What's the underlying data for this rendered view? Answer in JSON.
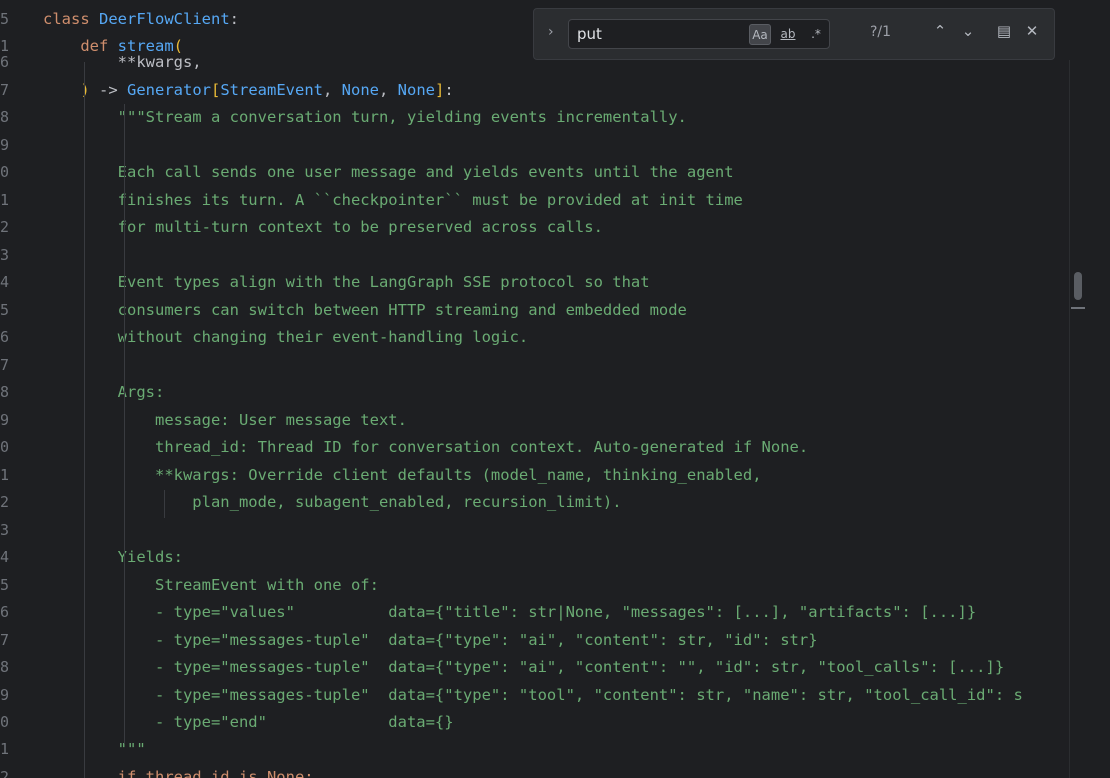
{
  "editor": {
    "lines": [
      {
        "n": "5",
        "html_parts": [
          {
            "t": "class ",
            "c": "kw"
          },
          {
            "t": "DeerFlowClient",
            "c": "cls"
          },
          {
            "t": ":",
            "c": "punc"
          }
        ]
      },
      {
        "n": "1",
        "html_parts": [
          {
            "t": "    def ",
            "c": "kw"
          },
          {
            "t": "stream",
            "c": "fn"
          },
          {
            "t": "(",
            "c": "brk"
          }
        ]
      },
      {
        "n": "6",
        "html_parts": [
          {
            "t": "        **kwargs,",
            "c": "punc"
          }
        ]
      },
      {
        "n": "7",
        "html_parts": [
          {
            "t": "    ",
            "c": "punc"
          },
          {
            "t": ")",
            "c": "brk"
          },
          {
            "t": " -> ",
            "c": "punc"
          },
          {
            "t": "Generator",
            "c": "cls"
          },
          {
            "t": "[",
            "c": "brk"
          },
          {
            "t": "StreamEvent",
            "c": "cls"
          },
          {
            "t": ", ",
            "c": "punc"
          },
          {
            "t": "None",
            "c": "none"
          },
          {
            "t": ", ",
            "c": "punc"
          },
          {
            "t": "None",
            "c": "none"
          },
          {
            "t": "]",
            "c": "brk"
          },
          {
            "t": ":",
            "c": "punc"
          }
        ]
      },
      {
        "n": "8",
        "html_parts": [
          {
            "t": "        \"\"\"Stream a conversation turn, yielding events incrementally.",
            "c": "doc"
          }
        ]
      },
      {
        "n": "9",
        "html_parts": []
      },
      {
        "n": "0",
        "html_parts": [
          {
            "t": "        Each call sends one user message and yields events until the agent",
            "c": "doc"
          }
        ]
      },
      {
        "n": "1",
        "html_parts": [
          {
            "t": "        finishes its turn. A ``checkpointer`` must be provided at init time",
            "c": "doc"
          }
        ]
      },
      {
        "n": "2",
        "html_parts": [
          {
            "t": "        for multi-turn context to be preserved across calls.",
            "c": "doc"
          }
        ]
      },
      {
        "n": "3",
        "html_parts": []
      },
      {
        "n": "4",
        "html_parts": [
          {
            "t": "        Event types align with the LangGraph SSE protocol so that",
            "c": "doc"
          }
        ]
      },
      {
        "n": "5",
        "html_parts": [
          {
            "t": "        consumers can switch between HTTP streaming and embedded mode",
            "c": "doc"
          }
        ]
      },
      {
        "n": "6",
        "html_parts": [
          {
            "t": "        without changing their event-handling logic.",
            "c": "doc"
          }
        ]
      },
      {
        "n": "7",
        "html_parts": []
      },
      {
        "n": "8",
        "html_parts": [
          {
            "t": "        Args:",
            "c": "doc"
          }
        ]
      },
      {
        "n": "9",
        "html_parts": [
          {
            "t": "            message: User message text.",
            "c": "doc"
          }
        ]
      },
      {
        "n": "0",
        "html_parts": [
          {
            "t": "            thread_id: Thread ID for conversation context. Auto-generated if None.",
            "c": "doc"
          }
        ]
      },
      {
        "n": "1",
        "html_parts": [
          {
            "t": "            **kwargs: Override client defaults (model_name, thinking_enabled,",
            "c": "doc"
          }
        ]
      },
      {
        "n": "2",
        "html_parts": [
          {
            "t": "                plan_mode, subagent_enabled, recursion_limit).",
            "c": "doc"
          }
        ]
      },
      {
        "n": "3",
        "html_parts": []
      },
      {
        "n": "4",
        "html_parts": [
          {
            "t": "        Yields:",
            "c": "doc"
          }
        ]
      },
      {
        "n": "5",
        "html_parts": [
          {
            "t": "            StreamEvent with one of:",
            "c": "doc"
          }
        ]
      },
      {
        "n": "6",
        "html_parts": [
          {
            "t": "            - type=\"values\"          data={\"title\": str|None, \"messages\": [...], \"artifacts\": [...]}",
            "c": "doc"
          }
        ]
      },
      {
        "n": "7",
        "html_parts": [
          {
            "t": "            - type=\"messages-tuple\"  data={\"type\": \"ai\", \"content\": str, \"id\": str}",
            "c": "doc"
          }
        ]
      },
      {
        "n": "8",
        "html_parts": [
          {
            "t": "            - type=\"messages-tuple\"  data={\"type\": \"ai\", \"content\": \"\", \"id\": str, \"tool_calls\": [...]}",
            "c": "doc"
          }
        ]
      },
      {
        "n": "9",
        "html_parts": [
          {
            "t": "            - type=\"messages-tuple\"  data={\"type\": \"tool\", \"content\": str, \"name\": str, \"tool_call_id\": s",
            "c": "doc"
          }
        ]
      },
      {
        "n": "0",
        "html_parts": [
          {
            "t": "            - type=\"end\"             data={}",
            "c": "doc"
          }
        ]
      },
      {
        "n": "1",
        "html_parts": [
          {
            "t": "        \"\"\"",
            "c": "doc"
          }
        ]
      },
      {
        "n": "2",
        "html_parts": [
          {
            "t": "        if thread_id is None:",
            "c": "kw"
          }
        ]
      }
    ]
  },
  "find": {
    "query": "put",
    "match_case_label": "Aa",
    "whole_word_label": "ab",
    "regex_label": ".*",
    "result_count": "?/1",
    "chevron": "›",
    "prev": "⌃",
    "next": "⌄",
    "filter": "▤",
    "close": "✕"
  },
  "colors": {
    "background": "#1e1f22",
    "keyword": "#cf8e6d",
    "identifier": "#56a8f5",
    "docstring": "#6aab73",
    "bracket": "#e8ba36"
  }
}
